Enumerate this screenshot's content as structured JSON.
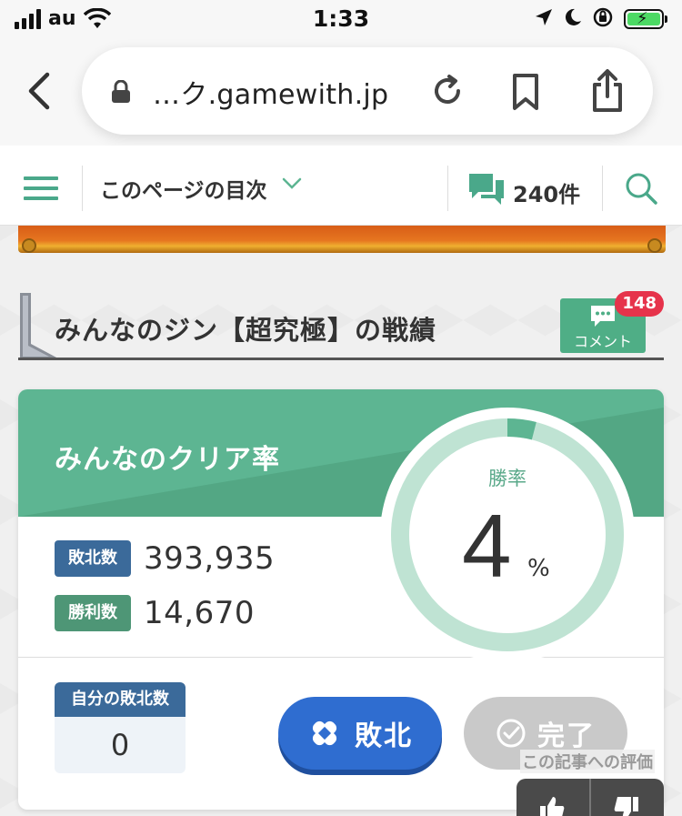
{
  "status_bar": {
    "carrier": "au",
    "time": "1:33",
    "icons": [
      "signal-icon",
      "wifi-icon",
      "location-icon",
      "moon-icon",
      "orientation-lock-icon",
      "battery-charging-icon"
    ]
  },
  "browser": {
    "url": "…ク.gamewith.jp",
    "icons": [
      "back-icon",
      "lock-icon",
      "reload-icon",
      "bookmark-icon",
      "share-icon"
    ]
  },
  "site_header": {
    "toc_label": "このページの目次",
    "comment_count": "240件",
    "icons": [
      "hamburger-icon",
      "chevron-down-icon",
      "comments-icon",
      "search-icon"
    ]
  },
  "section": {
    "title": "みんなのジン【超究極】の戦績",
    "comment_button_label": "コメント",
    "comment_badge": "148"
  },
  "stats": {
    "title": "みんなのクリア率",
    "loss_label": "敗北数",
    "loss_value": "393,935",
    "win_label": "勝利数",
    "win_value": "14,670",
    "rate_label": "勝率",
    "rate_value": "4",
    "rate_unit": "%",
    "rate_fraction": 0.04,
    "my_loss_label": "自分の敗北数",
    "my_loss_value": "0",
    "defeat_button": "敗北",
    "clear_button": "完了",
    "colors": {
      "accent_green": "#5db592",
      "loss_blue": "#3b6a9a",
      "defeat_blue": "#2f6dd0",
      "badge_red": "#e6334b"
    }
  },
  "rating": {
    "label": "この記事への評価",
    "icons": [
      "thumbs-up-icon",
      "thumbs-down-icon"
    ]
  }
}
